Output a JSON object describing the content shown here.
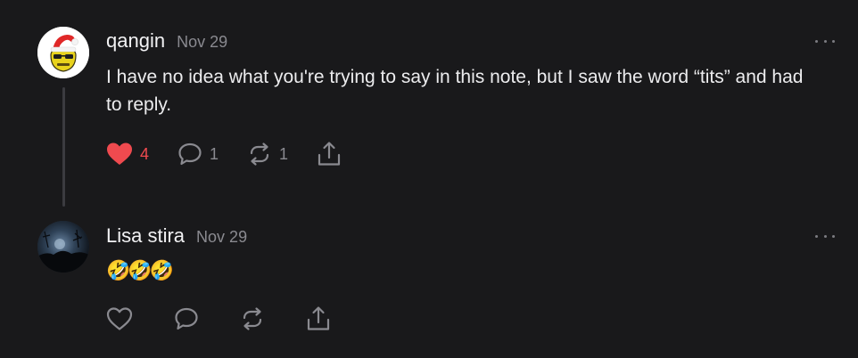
{
  "comments": [
    {
      "author": "qangin",
      "date": "Nov 29",
      "body": "I have no idea what you're trying to say in this note, but I saw the word “tits” and had to reply.",
      "likes": "4",
      "liked": true,
      "replies": "1",
      "restacks": "1",
      "avatar_icon": "santa-hat-avatar-icon"
    },
    {
      "author": "Lisa stira",
      "date": "Nov 29",
      "body": "🤣🤣🤣",
      "likes": "",
      "liked": false,
      "replies": "",
      "restacks": "",
      "avatar_icon": "night-sky-avatar-icon"
    }
  ],
  "icons": {
    "like": "heart-icon",
    "reply": "comment-bubble-icon",
    "restack": "restack-icon",
    "share": "share-icon",
    "more": "more-options-icon"
  },
  "colors": {
    "background": "#19191b",
    "text": "#ececee",
    "muted": "#8a8a90",
    "like_active": "#ef4a4f",
    "thread_line": "#3b3b40"
  }
}
